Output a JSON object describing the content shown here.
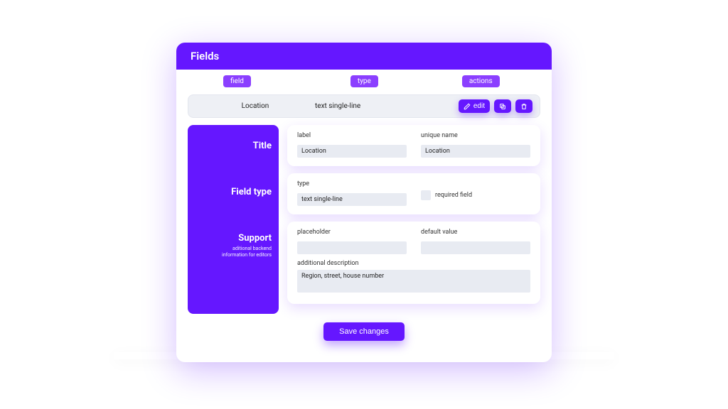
{
  "header": {
    "title": "Fields"
  },
  "columns": {
    "field": "field",
    "type": "type",
    "actions": "actions"
  },
  "row": {
    "name": "Location",
    "type": "text single-line",
    "edit": "edit"
  },
  "sidebar": {
    "title": "Title",
    "field_type": "Field type",
    "support": "Support",
    "support_sub1": "aditional backend",
    "support_sub2": "information for editors"
  },
  "card_title": {
    "label_label": "label",
    "label_value": "Location",
    "unique_label": "unique name",
    "unique_value": "Location"
  },
  "card_type": {
    "type_label": "type",
    "type_value": "text single-line",
    "required_label": "required field"
  },
  "card_support": {
    "placeholder_label": "placeholder",
    "placeholder_value": "",
    "default_label": "default value",
    "default_value": "",
    "desc_label": "additional description",
    "desc_value": "Region, street, house number"
  },
  "save": "Save changes",
  "colors": {
    "primary": "#6517ff",
    "chip": "#8b3fff",
    "input_bg": "#e8ebf2"
  }
}
